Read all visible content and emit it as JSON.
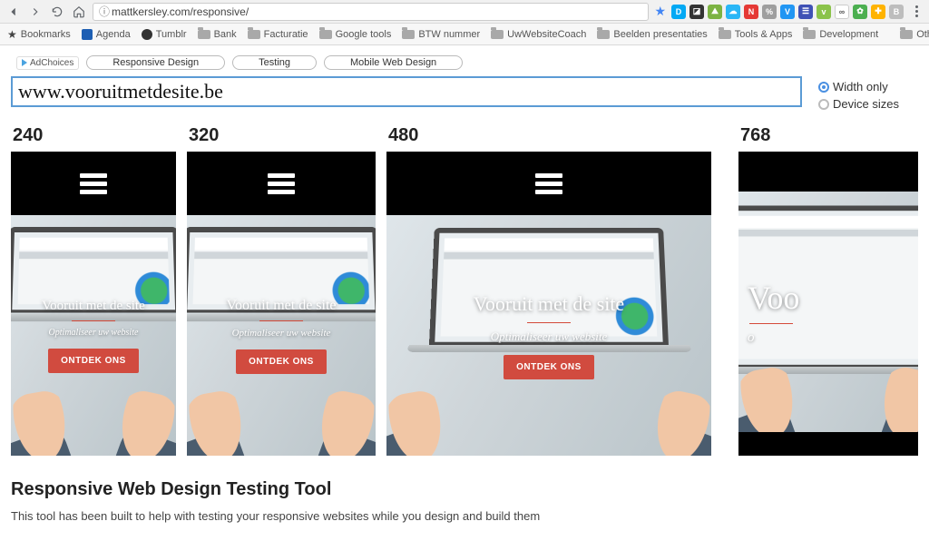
{
  "browser": {
    "url": "mattkersley.com/responsive/",
    "bookmarks": [
      "Bookmarks",
      "Agenda",
      "Tumblr",
      "Bank",
      "Facturatie",
      "Google tools",
      "BTW nummer",
      "UwWebsiteCoach",
      "Beelden presentaties",
      "Tools & Apps",
      "Development"
    ],
    "other_bookmarks": "Other Bookmarks"
  },
  "ads": {
    "adchoices": "AdChoices",
    "pills": [
      "Responsive Design",
      "Testing",
      "Mobile Web Design"
    ]
  },
  "input": {
    "url_value": "www.vooruitmetdesite.be"
  },
  "options": {
    "width_only": "Width only",
    "device_sizes": "Device sizes",
    "selected": "width_only"
  },
  "widths": [
    "240",
    "320",
    "480",
    "768"
  ],
  "preview_site": {
    "heading": "Vooruit met de site",
    "heading_short": "Voo",
    "sub": "Optimaliseer uw website",
    "sub_short": "o",
    "cta": "ONTDEK ONS"
  },
  "footer": {
    "heading": "Responsive Web Design Testing Tool",
    "body": "This tool has been built to help with testing your responsive websites while you design and build them"
  }
}
